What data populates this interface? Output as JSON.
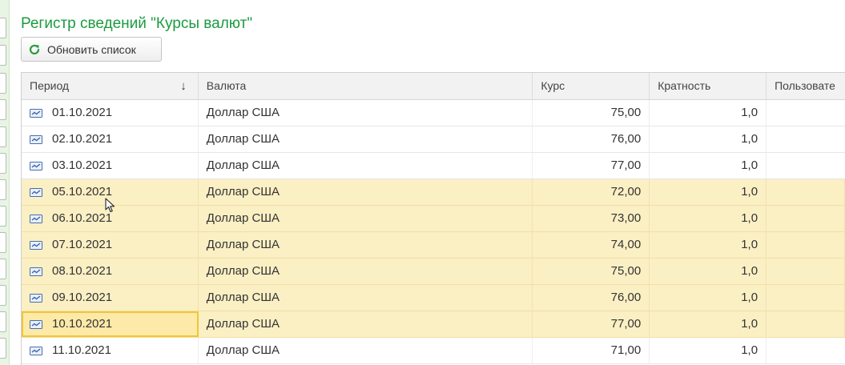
{
  "title": "Регистр сведений \"Курсы валют\"",
  "toolbar": {
    "refresh_label": "Обновить список"
  },
  "table": {
    "columns": [
      "Период",
      "Валюта",
      "Курс",
      "Кратность",
      "Пользовате"
    ],
    "rows": [
      {
        "period": "01.10.2021",
        "currency": "Доллар США",
        "rate": "75,00",
        "multiplicity": "1,0",
        "user": ""
      },
      {
        "period": "02.10.2021",
        "currency": "Доллар США",
        "rate": "76,00",
        "multiplicity": "1,0",
        "user": ""
      },
      {
        "period": "03.10.2021",
        "currency": "Доллар США",
        "rate": "77,00",
        "multiplicity": "1,0",
        "user": ""
      },
      {
        "period": "05.10.2021",
        "currency": "Доллар США",
        "rate": "72,00",
        "multiplicity": "1,0",
        "user": ""
      },
      {
        "period": "06.10.2021",
        "currency": "Доллар США",
        "rate": "73,00",
        "multiplicity": "1,0",
        "user": ""
      },
      {
        "period": "07.10.2021",
        "currency": "Доллар США",
        "rate": "74,00",
        "multiplicity": "1,0",
        "user": ""
      },
      {
        "period": "08.10.2021",
        "currency": "Доллар США",
        "rate": "75,00",
        "multiplicity": "1,0",
        "user": ""
      },
      {
        "period": "09.10.2021",
        "currency": "Доллар США",
        "rate": "76,00",
        "multiplicity": "1,0",
        "user": ""
      },
      {
        "period": "10.10.2021",
        "currency": "Доллар США",
        "rate": "77,00",
        "multiplicity": "1,0",
        "user": ""
      },
      {
        "period": "11.10.2021",
        "currency": "Доллар США",
        "rate": "71,00",
        "multiplicity": "1,0",
        "user": ""
      }
    ],
    "selected_rows": [
      3,
      4,
      5,
      6,
      7,
      8
    ],
    "current_row": 8
  },
  "icons": {
    "refresh": "refresh-icon",
    "record": "record-icon",
    "sort": "sort-descending-icon"
  },
  "colors": {
    "title": "#1c9b3f",
    "refresh_icon": "#2a9d3f",
    "selection": "#fbefc4",
    "current_cell_border": "#f0c63a"
  }
}
